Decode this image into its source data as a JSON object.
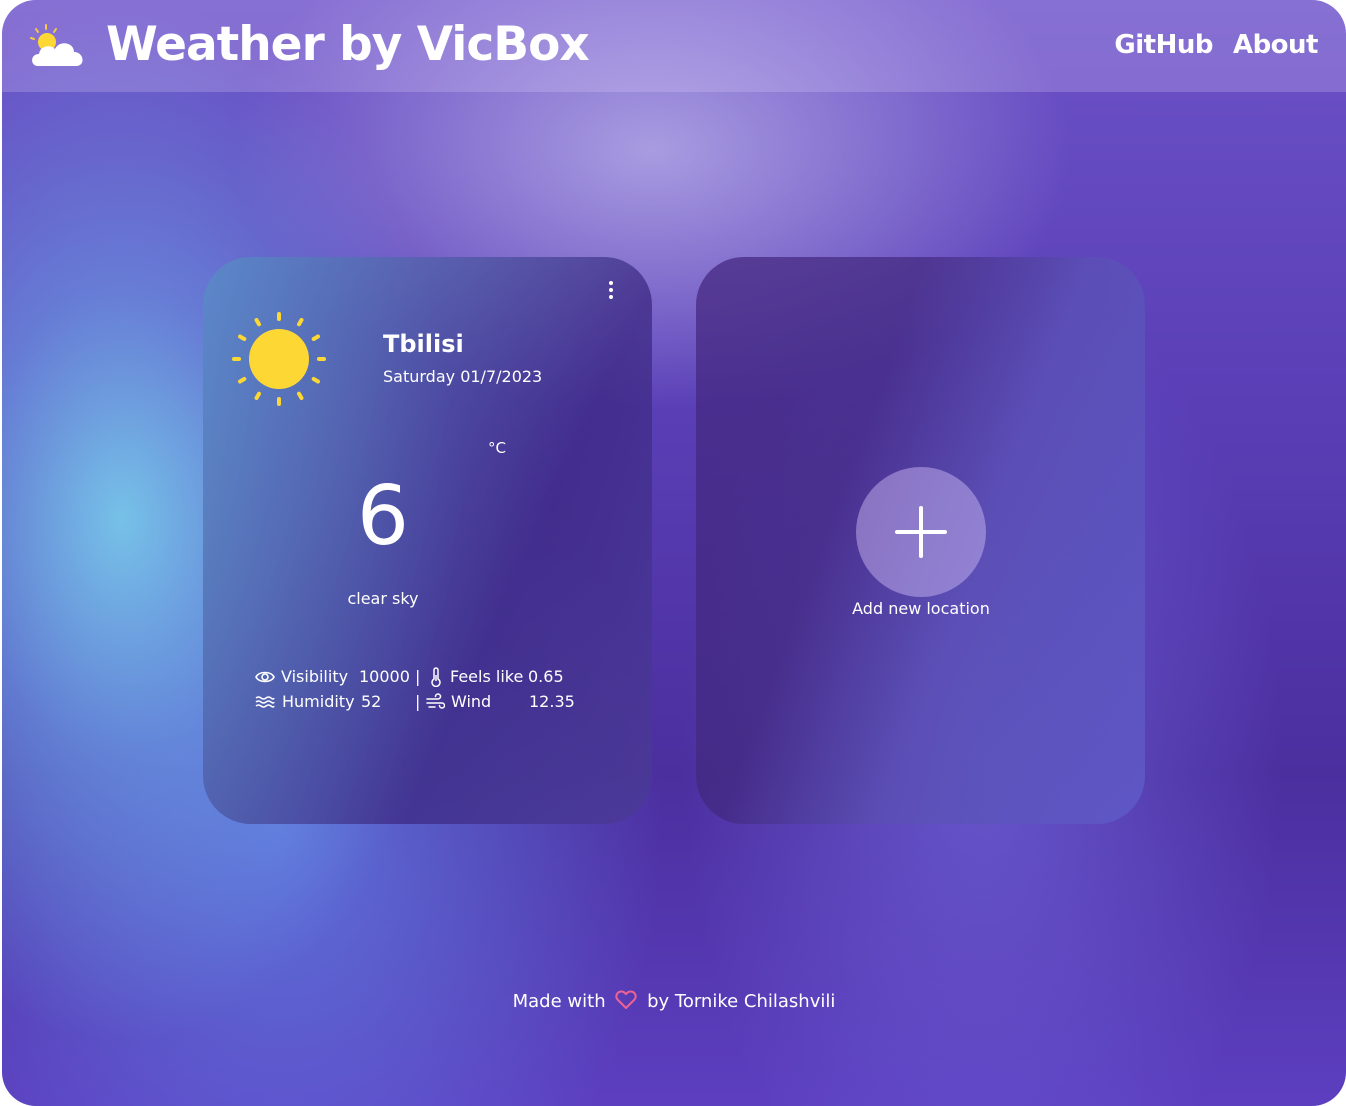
{
  "header": {
    "title": "Weather by VicBox",
    "nav": {
      "github": "GitHub",
      "about": "About"
    }
  },
  "weather_card": {
    "city": "Tbilisi",
    "date": "Saturday 01/7/2023",
    "unit": "°C",
    "temperature": "6",
    "description": "clear sky",
    "icon": "sun-icon",
    "stats": {
      "visibility_label": "Visibility",
      "visibility_value": "10000",
      "feels_like_label": "Feels like",
      "feels_like_value": "0.65",
      "humidity_label": "Humidity",
      "humidity_value": "52",
      "wind_label": "Wind",
      "wind_value": "12.35",
      "separator": "|"
    }
  },
  "add_card": {
    "label": "Add new location",
    "icon": "plus-icon"
  },
  "footer": {
    "prefix": "Made with",
    "suffix": "by Tornike Chilashvili",
    "icon": "heart-icon"
  },
  "colors": {
    "sun": "#fdd835",
    "heart": "#f06292"
  }
}
